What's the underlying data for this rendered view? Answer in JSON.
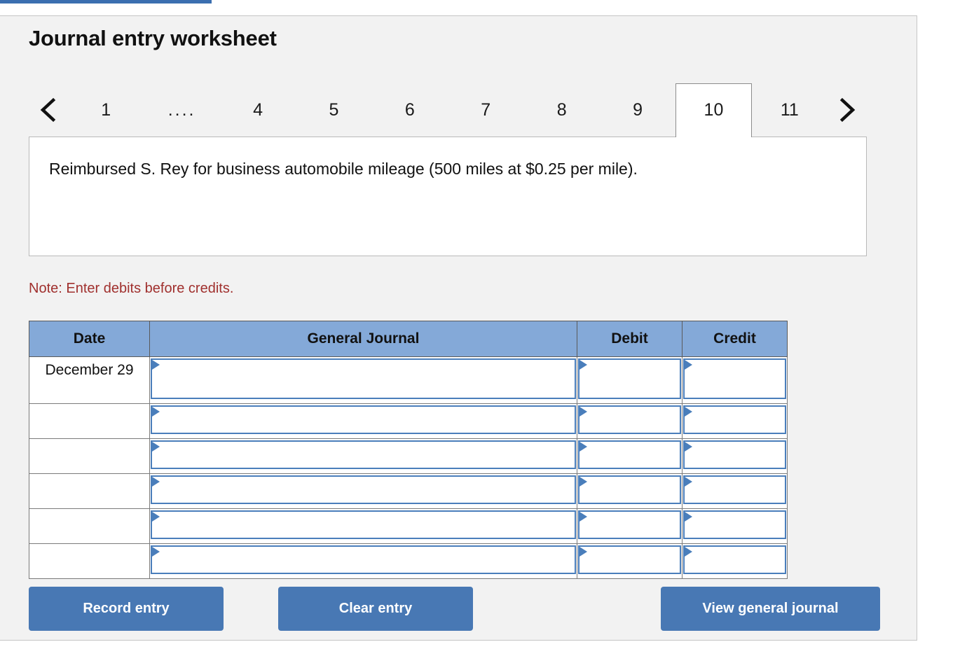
{
  "page": {
    "title": "Journal entry worksheet"
  },
  "tabs": {
    "prev_icon": "chevron-left-icon",
    "next_icon": "chevron-right-icon",
    "items": [
      {
        "label": "1",
        "active": false,
        "kind": "number"
      },
      {
        "label": "....",
        "active": false,
        "kind": "ellipsis"
      },
      {
        "label": "4",
        "active": false,
        "kind": "number"
      },
      {
        "label": "5",
        "active": false,
        "kind": "number"
      },
      {
        "label": "6",
        "active": false,
        "kind": "number"
      },
      {
        "label": "7",
        "active": false,
        "kind": "number"
      },
      {
        "label": "8",
        "active": false,
        "kind": "number"
      },
      {
        "label": "9",
        "active": false,
        "kind": "number"
      },
      {
        "label": "10",
        "active": true,
        "kind": "number"
      },
      {
        "label": "11",
        "active": false,
        "kind": "number"
      }
    ],
    "active_label": "10"
  },
  "transaction": {
    "description": "Reimbursed S. Rey for business automobile mileage (500 miles at $0.25 per mile)."
  },
  "note": {
    "text": "Note: Enter debits before credits.",
    "color": "#a0302e"
  },
  "journal": {
    "headers": [
      "Date",
      "General Journal",
      "Debit",
      "Credit"
    ],
    "rows": [
      {
        "date": "December 29",
        "general_journal": "",
        "debit": "",
        "credit": ""
      },
      {
        "date": "",
        "general_journal": "",
        "debit": "",
        "credit": ""
      },
      {
        "date": "",
        "general_journal": "",
        "debit": "",
        "credit": ""
      },
      {
        "date": "",
        "general_journal": "",
        "debit": "",
        "credit": ""
      },
      {
        "date": "",
        "general_journal": "",
        "debit": "",
        "credit": ""
      },
      {
        "date": "",
        "general_journal": "",
        "debit": "",
        "credit": ""
      }
    ],
    "header_bg": "#84a9d8",
    "cell_border": "#4a7ebb"
  },
  "buttons": {
    "record": "Record entry",
    "clear": "Clear entry",
    "view": "View general journal",
    "color": "#4878b4"
  },
  "theme": {
    "panel_bg": "#f2f2f2",
    "accent_blue": "#3b6fb0"
  }
}
